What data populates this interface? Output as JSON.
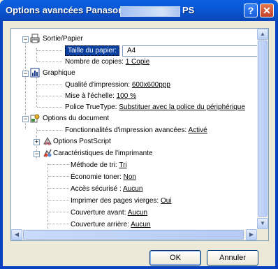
{
  "window": {
    "title": "Options avancées Panasonic",
    "title_suffix": "PS",
    "help_label": "?",
    "close_label": "✕"
  },
  "tree": {
    "sortie_papier": "Sortie/Papier",
    "taille_label": "Taille du papier:",
    "taille_value": "A4",
    "copies_label": "Nombre de copies:",
    "copies_value": "1 Copie",
    "graphique": "Graphique",
    "qualite_label": "Qualité d'impression:",
    "qualite_value": "600x600ppp",
    "echelle_label": "Mise à l'échelle:",
    "echelle_value": "100 %",
    "police_label": "Police TrueType:",
    "police_value": "Substituer avec la police du périphérique",
    "options_doc": "Options du document",
    "fonctionnalites_label": "Fonctionnalités d'impression avancées:",
    "fonctionnalites_value": "Activé",
    "options_ps": "Options PostScript",
    "caracteristiques": "Caractéristiques de l'imprimante",
    "tri_label": "Méthode de tri:",
    "tri_value": "Tri",
    "toner_label": "Économie toner:",
    "toner_value": "Non",
    "acces_label": "Accès sécurisé :",
    "acces_value": "Aucun",
    "vierges_label": "Imprimer des pages vierges:",
    "vierges_value": "Oui",
    "couv_avant_label": "Couverture avant:",
    "couv_avant_value": "Aucun",
    "couv_arriere_label": "Couverture arrière:",
    "couv_arriere_value": "Aucun"
  },
  "buttons": {
    "ok": "OK",
    "cancel": "Annuler"
  },
  "colors": {
    "titlebar": "#0a58d6",
    "selection": "#0b3f9e",
    "dialog_bg": "#ece9d8"
  }
}
